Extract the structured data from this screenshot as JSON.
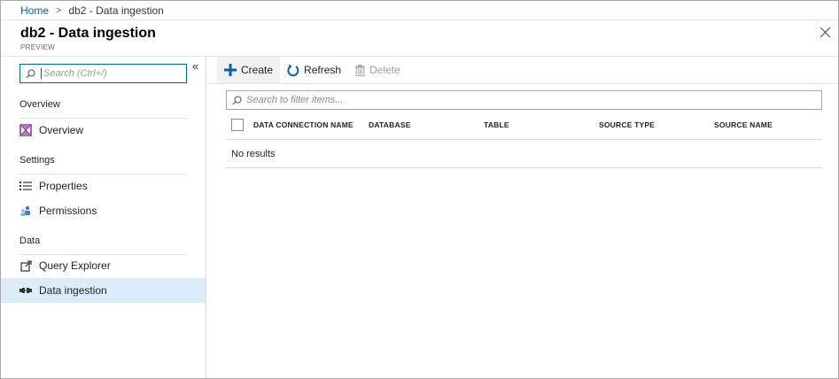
{
  "breadcrumb": {
    "home": "Home",
    "separator": ">",
    "current": "db2 - Data ingestion"
  },
  "blade": {
    "title": "db2 - Data ingestion",
    "subtitle": "PREVIEW"
  },
  "sidebar": {
    "search_placeholder": "Search (Ctrl+/)",
    "collapse_label": "«",
    "sections": [
      {
        "header": "Overview",
        "items": [
          {
            "label": "Overview",
            "icon": "overview-icon"
          }
        ]
      },
      {
        "header": "Settings",
        "items": [
          {
            "label": "Properties",
            "icon": "properties-list-icon"
          },
          {
            "label": "Permissions",
            "icon": "permissions-users-icon"
          }
        ]
      },
      {
        "header": "Data",
        "items": [
          {
            "label": "Query Explorer",
            "icon": "external-link-icon"
          },
          {
            "label": "Data ingestion",
            "icon": "data-ingestion-icon",
            "active": true
          }
        ]
      }
    ]
  },
  "toolbar": {
    "create": "Create",
    "refresh": "Refresh",
    "delete": "Delete"
  },
  "filter": {
    "placeholder": "Search to filter items..."
  },
  "table": {
    "columns": [
      "DATA CONNECTION NAME",
      "DATABASE",
      "TABLE",
      "SOURCE TYPE",
      "SOURCE NAME"
    ],
    "empty_text": "No results"
  },
  "colors": {
    "accent": "#0062ad",
    "active_nav": "#dcecfa",
    "disabled": "#a0a0a0"
  }
}
